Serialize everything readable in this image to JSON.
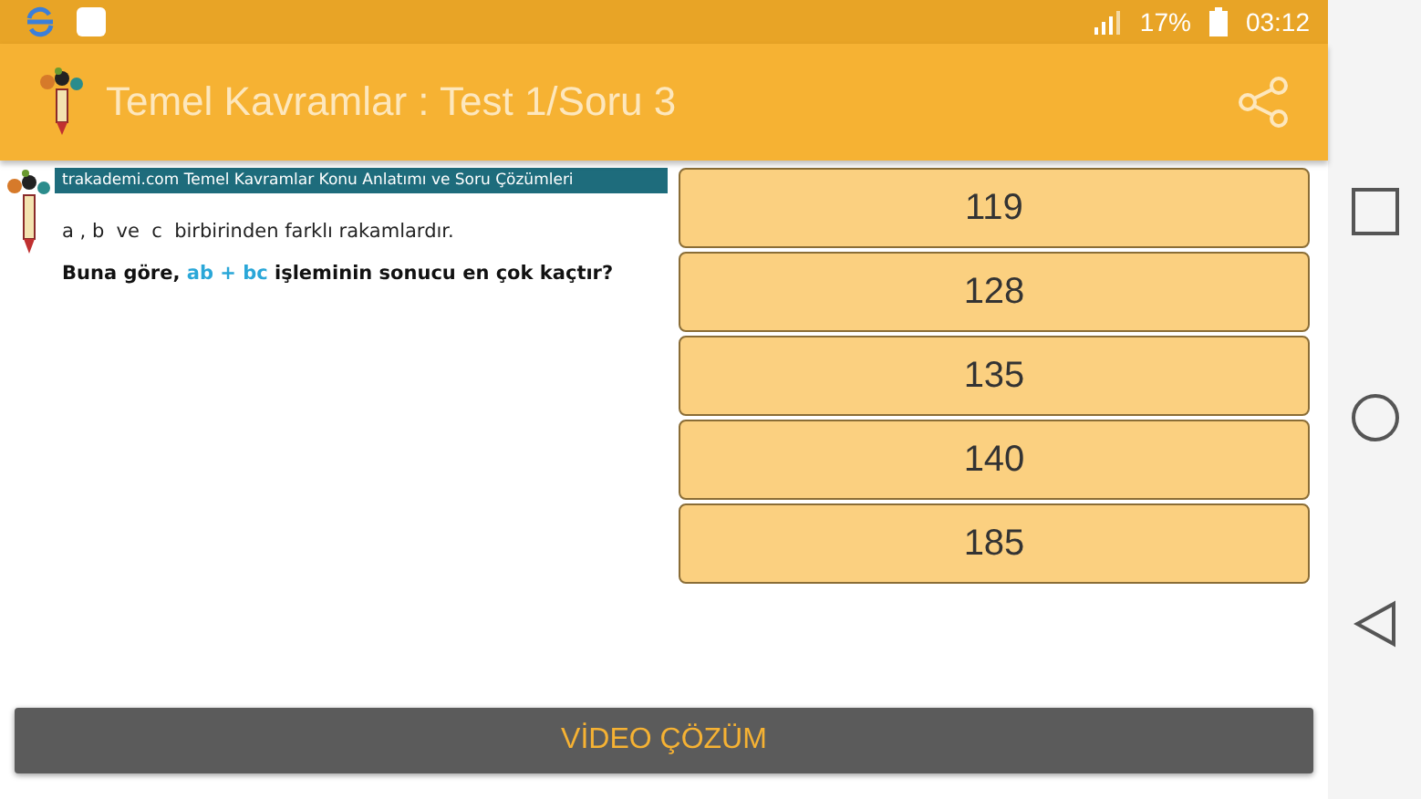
{
  "status_bar": {
    "battery": "17%",
    "time": "03:12"
  },
  "app_bar": {
    "title": "Temel Kavramlar : Test 1/Soru 3"
  },
  "question": {
    "banner": "trakademi.com   Temel Kavramlar  Konu Anlatımı ve Soru Çözümleri",
    "statement": "a , b  ve  c  birbirinden farklı rakamlardır.",
    "prompt_lead": "Buna göre,",
    "prompt_expression": "ab + bc",
    "prompt_rest": "işleminin sonucu en çok kaçtır?"
  },
  "answers": [
    "119",
    "128",
    "135",
    "140",
    "185"
  ],
  "video_button": "VİDEO ÇÖZÜM"
}
